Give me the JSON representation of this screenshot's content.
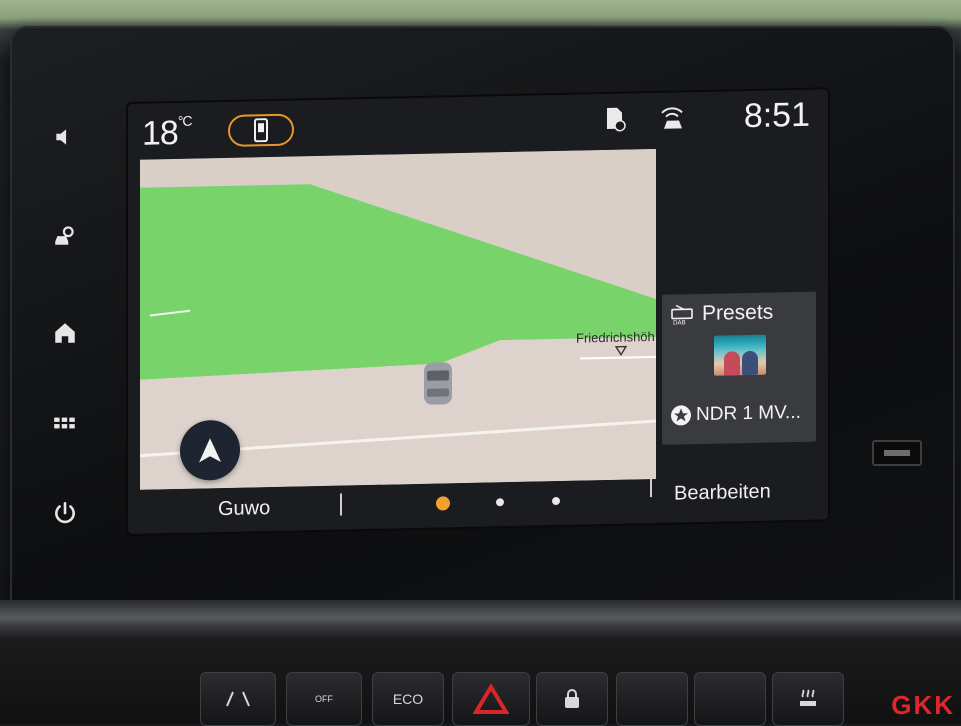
{
  "status_bar": {
    "temperature": "18",
    "temperature_unit": "°C",
    "time": "8:51",
    "phone_icon": "phone-projection-icon",
    "doc_icon": "notification-doc-icon",
    "connected_car_icon": "connected-car-icon"
  },
  "sidebar": {
    "items": [
      {
        "icon": "speaker-icon"
      },
      {
        "icon": "vehicle-settings-icon"
      },
      {
        "icon": "home-icon"
      },
      {
        "icon": "apps-grid-icon"
      },
      {
        "icon": "power-icon"
      }
    ]
  },
  "map": {
    "place_label": "Friedrichshöh",
    "nav_button_icon": "navigation-arrow-icon"
  },
  "radio": {
    "title": "Presets",
    "source_icon": "dab-radio-icon",
    "station": "NDR 1 MV..."
  },
  "bottom_bar": {
    "nav_label": "Guwo",
    "edit_label": "Bearbeiten",
    "page_dots": 3,
    "active_page": 1
  },
  "dashboard": {
    "eco_label": "ECO",
    "off_label": "OFF"
  },
  "watermark": "GKK",
  "colors": {
    "accent": "#f0a12e",
    "map_green": "#78d36a",
    "map_land": "#d9cfc7",
    "hazard": "#d8262b"
  }
}
